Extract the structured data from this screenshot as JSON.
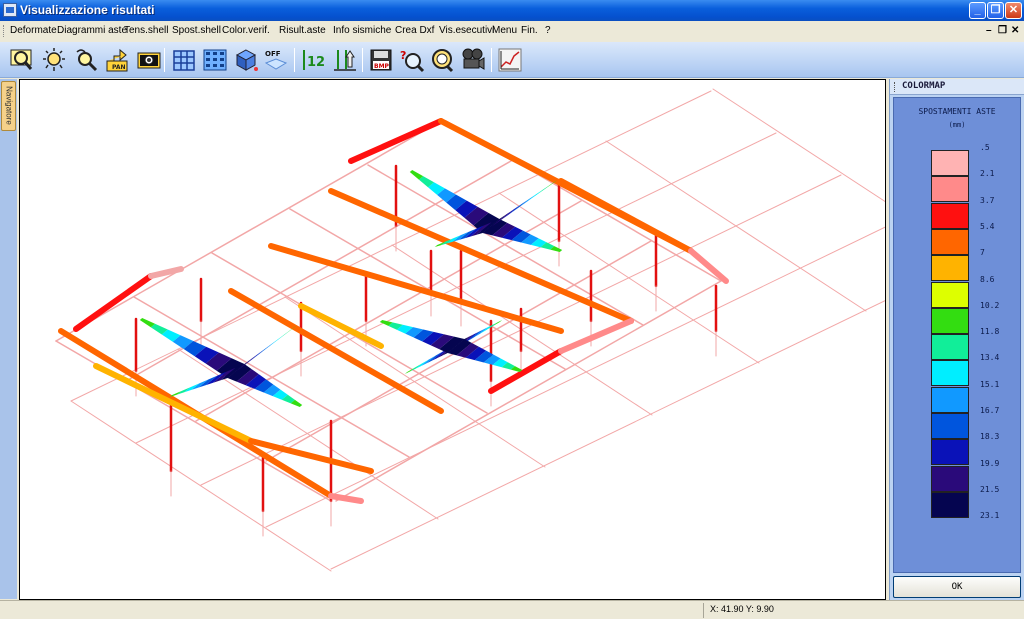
{
  "window": {
    "title": "Visualizzazione risultati"
  },
  "menu": {
    "items": [
      "Deformate",
      "Diagrammi aste",
      "Tens.shell",
      "Spost.shell",
      "Color.verif.",
      "Risult.aste",
      "Info sismiche",
      "Crea Dxf",
      "Vis.esecutivi",
      "Menu",
      "Fin.",
      "?"
    ]
  },
  "toolbar": {
    "tools": [
      "zoom-window-icon",
      "zoom-extents-icon",
      "zoom-realtime-icon",
      "pan-icon",
      "camera-icon",
      "building-frame-icon",
      "building-grid-icon",
      "3d-view-icon",
      "view-off-icon",
      "12-numbering-icon",
      "loads-icon",
      "bmp-export-icon",
      "query-icon",
      "zoom-search-icon",
      "video-camera-icon",
      "chart-icon"
    ],
    "pan_label": "PAN",
    "off_label": "OFF",
    "num_label": "12",
    "bmp_label": "BMP"
  },
  "navigator": {
    "label": "Navigatore"
  },
  "colormap": {
    "panel_title": "COLORMAP",
    "title": "SPOSTAMENTI ASTE",
    "unit": "(mm)",
    "levels": [
      {
        "label": ".5",
        "color": "#ffb3b3"
      },
      {
        "label": "2.1",
        "color": "#ff8a8a"
      },
      {
        "label": "3.7",
        "color": "#ff1010"
      },
      {
        "label": "5.4",
        "color": "#ff6600"
      },
      {
        "label": "7",
        "color": "#ffb300"
      },
      {
        "label": "8.6",
        "color": "#ddff00"
      },
      {
        "label": "10.2",
        "color": "#33dd11"
      },
      {
        "label": "11.8",
        "color": "#11ee99"
      },
      {
        "label": "13.4",
        "color": "#00eeff"
      },
      {
        "label": "15.1",
        "color": "#1199ff"
      },
      {
        "label": "16.7",
        "color": "#0055dd"
      },
      {
        "label": "18.3",
        "color": "#0a12b8"
      },
      {
        "label": "19.9",
        "color": "#2a0a7a"
      },
      {
        "label": "21.5",
        "color": "#050550"
      }
    ],
    "last_label": "23.1",
    "ok_label": "OK"
  },
  "status": {
    "coords": "X: 41.90  Y:  9.90"
  }
}
